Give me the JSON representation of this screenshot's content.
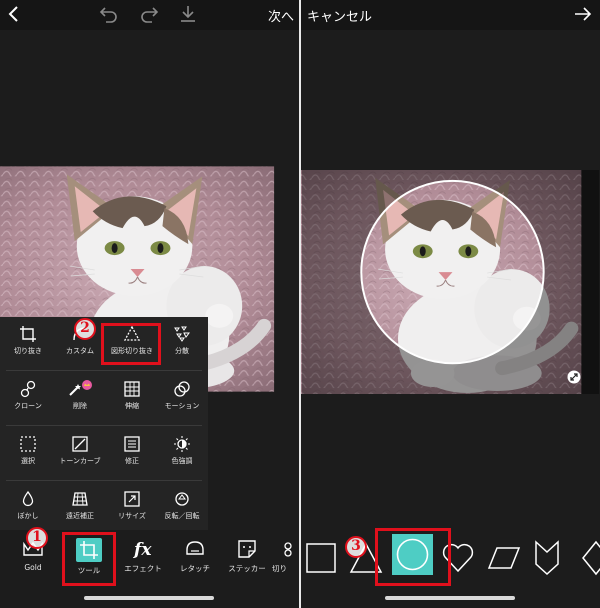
{
  "left": {
    "header": {
      "next_label": "次へ"
    },
    "tools": [
      {
        "label": "切り抜き",
        "icon": "crop-icon"
      },
      {
        "label": "カスタム",
        "icon": "custom-crop-icon"
      },
      {
        "label": "図形切り抜き",
        "icon": "shape-crop-icon"
      },
      {
        "label": "分散",
        "icon": "disperse-icon"
      },
      {
        "label": "クローン",
        "icon": "clone-icon"
      },
      {
        "label": "削除",
        "icon": "remove-icon"
      },
      {
        "label": "伸縮",
        "icon": "stretch-icon"
      },
      {
        "label": "モーション",
        "icon": "motion-icon"
      },
      {
        "label": "選択",
        "icon": "select-icon"
      },
      {
        "label": "トーンカーブ",
        "icon": "tone-curve-icon"
      },
      {
        "label": "修正",
        "icon": "adjust-icon"
      },
      {
        "label": "色強調",
        "icon": "color-enhance-icon"
      },
      {
        "label": "ぼかし",
        "icon": "blur-icon"
      },
      {
        "label": "遠近補正",
        "icon": "perspective-icon"
      },
      {
        "label": "リサイズ",
        "icon": "resize-icon"
      },
      {
        "label": "反転／回転",
        "icon": "flip-rotate-icon"
      }
    ],
    "nav": [
      {
        "label": "Gold",
        "icon": "gold-crown-icon"
      },
      {
        "label": "ツール",
        "icon": "tool-crop-icon"
      },
      {
        "label": "エフェクト",
        "icon": "fx-icon"
      },
      {
        "label": "レタッチ",
        "icon": "retouch-icon"
      },
      {
        "label": "ステッカー",
        "icon": "sticker-icon"
      },
      {
        "label": "切り",
        "icon": "cutout-icon"
      }
    ]
  },
  "right": {
    "header": {
      "cancel_label": "キャンセル"
    },
    "shapes": [
      "square-shape-icon",
      "triangle-shape-icon",
      "circle-shape-icon",
      "heart-shape-icon",
      "parallelogram-shape-icon",
      "chevron-shape-icon",
      "diamond-shape-icon"
    ],
    "selected_shape": "circle-shape-icon"
  },
  "annotations": {
    "step1": "1",
    "step2": "2",
    "step3": "3"
  },
  "colors": {
    "accent": "#4ecdc4",
    "annotation": "#e0101c",
    "background": "#1c1c1c"
  }
}
